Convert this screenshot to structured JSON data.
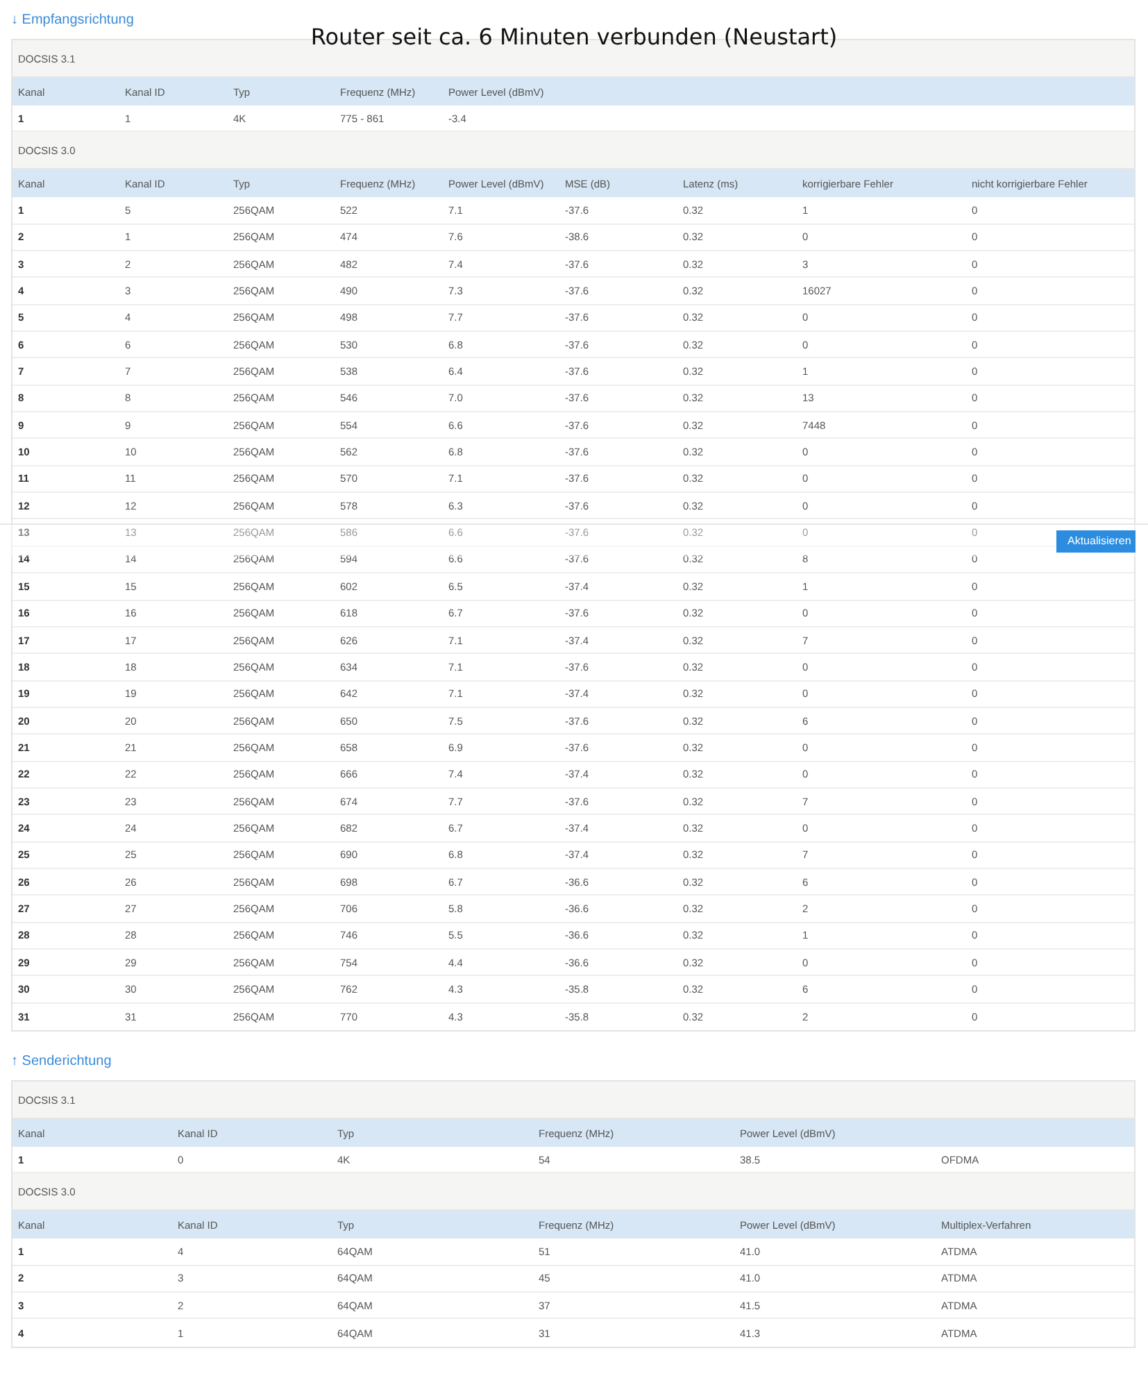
{
  "title": "Router seit ca. 6 Minuten verbunden (Neustart)",
  "sections": [
    {
      "heading": "↓ Empfangsrichtung",
      "groups": [
        {
          "label": "DOCSIS 3.1",
          "columns": [
            "Kanal",
            "Kanal ID",
            "Typ",
            "Frequenz (MHz)",
            "Power Level (dBmV)"
          ],
          "rows": [
            [
              "1",
              "1",
              "4K",
              "775 - 861",
              "-3.4"
            ]
          ]
        },
        {
          "label": "DOCSIS 3.0",
          "columns": [
            "Kanal",
            "Kanal ID",
            "Typ",
            "Frequenz (MHz)",
            "Power Level (dBmV)",
            "MSE (dB)",
            "Latenz (ms)",
            "korrigierbare Fehler",
            "nicht korrigierbare Fehler"
          ],
          "rows": [
            [
              "1",
              "5",
              "256QAM",
              "522",
              "7.1",
              "-37.6",
              "0.32",
              "1",
              "0"
            ],
            [
              "2",
              "1",
              "256QAM",
              "474",
              "7.6",
              "-38.6",
              "0.32",
              "0",
              "0"
            ],
            [
              "3",
              "2",
              "256QAM",
              "482",
              "7.4",
              "-37.6",
              "0.32",
              "3",
              "0"
            ],
            [
              "4",
              "3",
              "256QAM",
              "490",
              "7.3",
              "-37.6",
              "0.32",
              "16027",
              "0"
            ],
            [
              "5",
              "4",
              "256QAM",
              "498",
              "7.7",
              "-37.6",
              "0.32",
              "0",
              "0"
            ],
            [
              "6",
              "6",
              "256QAM",
              "530",
              "6.8",
              "-37.6",
              "0.32",
              "0",
              "0"
            ],
            [
              "7",
              "7",
              "256QAM",
              "538",
              "6.4",
              "-37.6",
              "0.32",
              "1",
              "0"
            ],
            [
              "8",
              "8",
              "256QAM",
              "546",
              "7.0",
              "-37.6",
              "0.32",
              "13",
              "0"
            ],
            [
              "9",
              "9",
              "256QAM",
              "554",
              "6.6",
              "-37.6",
              "0.32",
              "7448",
              "0"
            ],
            [
              "10",
              "10",
              "256QAM",
              "562",
              "6.8",
              "-37.6",
              "0.32",
              "0",
              "0"
            ],
            [
              "11",
              "11",
              "256QAM",
              "570",
              "7.1",
              "-37.6",
              "0.32",
              "0",
              "0"
            ],
            [
              "12",
              "12",
              "256QAM",
              "578",
              "6.3",
              "-37.6",
              "0.32",
              "0",
              "0"
            ],
            [
              "13",
              "13",
              "256QAM",
              "586",
              "6.6",
              "-37.6",
              "0.32",
              "0",
              "0"
            ],
            [
              "14",
              "14",
              "256QAM",
              "594",
              "6.6",
              "-37.6",
              "0.32",
              "8",
              "0"
            ],
            [
              "15",
              "15",
              "256QAM",
              "602",
              "6.5",
              "-37.4",
              "0.32",
              "1",
              "0"
            ],
            [
              "16",
              "16",
              "256QAM",
              "618",
              "6.7",
              "-37.6",
              "0.32",
              "0",
              "0"
            ],
            [
              "17",
              "17",
              "256QAM",
              "626",
              "7.1",
              "-37.4",
              "0.32",
              "7",
              "0"
            ],
            [
              "18",
              "18",
              "256QAM",
              "634",
              "7.1",
              "-37.6",
              "0.32",
              "0",
              "0"
            ],
            [
              "19",
              "19",
              "256QAM",
              "642",
              "7.1",
              "-37.4",
              "0.32",
              "0",
              "0"
            ],
            [
              "20",
              "20",
              "256QAM",
              "650",
              "7.5",
              "-37.6",
              "0.32",
              "6",
              "0"
            ],
            [
              "21",
              "21",
              "256QAM",
              "658",
              "6.9",
              "-37.6",
              "0.32",
              "0",
              "0"
            ],
            [
              "22",
              "22",
              "256QAM",
              "666",
              "7.4",
              "-37.4",
              "0.32",
              "0",
              "0"
            ],
            [
              "23",
              "23",
              "256QAM",
              "674",
              "7.7",
              "-37.6",
              "0.32",
              "7",
              "0"
            ],
            [
              "24",
              "24",
              "256QAM",
              "682",
              "6.7",
              "-37.4",
              "0.32",
              "0",
              "0"
            ],
            [
              "25",
              "25",
              "256QAM",
              "690",
              "6.8",
              "-37.4",
              "0.32",
              "7",
              "0"
            ],
            [
              "26",
              "26",
              "256QAM",
              "698",
              "6.7",
              "-36.6",
              "0.32",
              "6",
              "0"
            ],
            [
              "27",
              "27",
              "256QAM",
              "706",
              "5.8",
              "-36.6",
              "0.32",
              "2",
              "0"
            ],
            [
              "28",
              "28",
              "256QAM",
              "746",
              "5.5",
              "-36.6",
              "0.32",
              "1",
              "0"
            ],
            [
              "29",
              "29",
              "256QAM",
              "754",
              "4.4",
              "-36.6",
              "0.32",
              "0",
              "0"
            ],
            [
              "30",
              "30",
              "256QAM",
              "762",
              "4.3",
              "-35.8",
              "0.32",
              "6",
              "0"
            ],
            [
              "31",
              "31",
              "256QAM",
              "770",
              "4.3",
              "-35.8",
              "0.32",
              "2",
              "0"
            ]
          ]
        }
      ]
    },
    {
      "heading": "↑ Senderichtung",
      "groups": [
        {
          "label": "DOCSIS 3.1",
          "columns": [
            "Kanal",
            "Kanal ID",
            "Typ",
            "Frequenz (MHz)",
            "Power Level (dBmV)"
          ],
          "rows": [
            [
              "1",
              "0",
              "4K",
              "54",
              "38.5",
              "OFDMA"
            ]
          ]
        },
        {
          "label": "DOCSIS 3.0",
          "columns": [
            "Kanal",
            "Kanal ID",
            "Typ",
            "Frequenz (MHz)",
            "Power Level (dBmV)",
            "Multiplex-Verfahren"
          ],
          "rows": [
            [
              "1",
              "4",
              "64QAM",
              "51",
              "41.0",
              "ATDMA"
            ],
            [
              "2",
              "3",
              "64QAM",
              "45",
              "41.0",
              "ATDMA"
            ],
            [
              "3",
              "2",
              "64QAM",
              "37",
              "41.5",
              "ATDMA"
            ],
            [
              "4",
              "1",
              "64QAM",
              "31",
              "41.3",
              "ATDMA"
            ]
          ]
        }
      ]
    }
  ],
  "refresh_button": {
    "label": "Aktualisieren"
  }
}
